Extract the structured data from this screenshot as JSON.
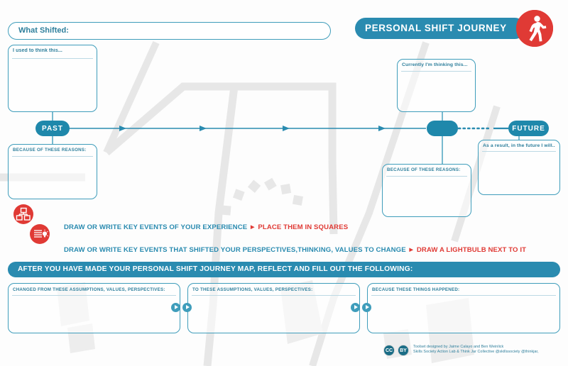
{
  "header": {
    "title": "PERSONAL SHIFT JOURNEY",
    "badge_icon": "walking-person-icon"
  },
  "top_prompt": {
    "label": "What Shifted:"
  },
  "timeline": {
    "past_label": "PAST",
    "future_label": "FUTURE",
    "arrow_marker_count": 4,
    "dotted_segment": true
  },
  "boxes": {
    "past_thought": "I used to think this...",
    "past_reasons": "BECAUSE OF THESE REASONS:",
    "current_thought": "Currently I'm thinking this...",
    "current_reasons": "BECAUSE OF THESE REASONS:",
    "future_thought": "As a result, in the future I will..."
  },
  "instructions": [
    {
      "icon": "squares-icon",
      "blue_text": "DRAW OR WRITE KEY EVENTS OF YOUR EXPERIENCE ",
      "marker": "►",
      "red_text": " PLACE THEM IN SQUARES"
    },
    {
      "icon": "lightbulb-icon",
      "blue_text": "DRAW OR WRITE KEY EVENTS THAT SHIFTED YOUR PERSPECTIVES,THINKING, VALUES TO CHANGE ",
      "marker": "►",
      "red_text": " DRAW A LIGHTBULB NEXT TO IT"
    }
  ],
  "reflect": {
    "banner": "AFTER YOU HAVE MADE YOUR PERSONAL SHIFT JOURNEY MAP, REFLECT AND FILL OUT THE FOLLOWING:",
    "fields": [
      "CHANGED FROM THESE ASSUMPTIONS, VALUES, PERSPECTIVES:",
      "TO THESE ASSUMPTIONS, VALUES, PERSPECTIVES:",
      "BECAUSE THESE THINGS HAPPENED:"
    ]
  },
  "credits": {
    "cc_label": "CC",
    "by_label": "BY",
    "line1": "Toolset designed by Jaime Calayo and Ben Weinlick",
    "line2": "Skills Society Action Lab & Think Jar Collective @skillssociety  @thinkjar,"
  },
  "colors": {
    "teal": "#2a8bb0",
    "teal_dark": "#1f88ab",
    "stroke": "#3f9dbb",
    "label_text": "#2e7f9c",
    "red": "#e03a35",
    "map_grey": "#e6e6e6"
  }
}
